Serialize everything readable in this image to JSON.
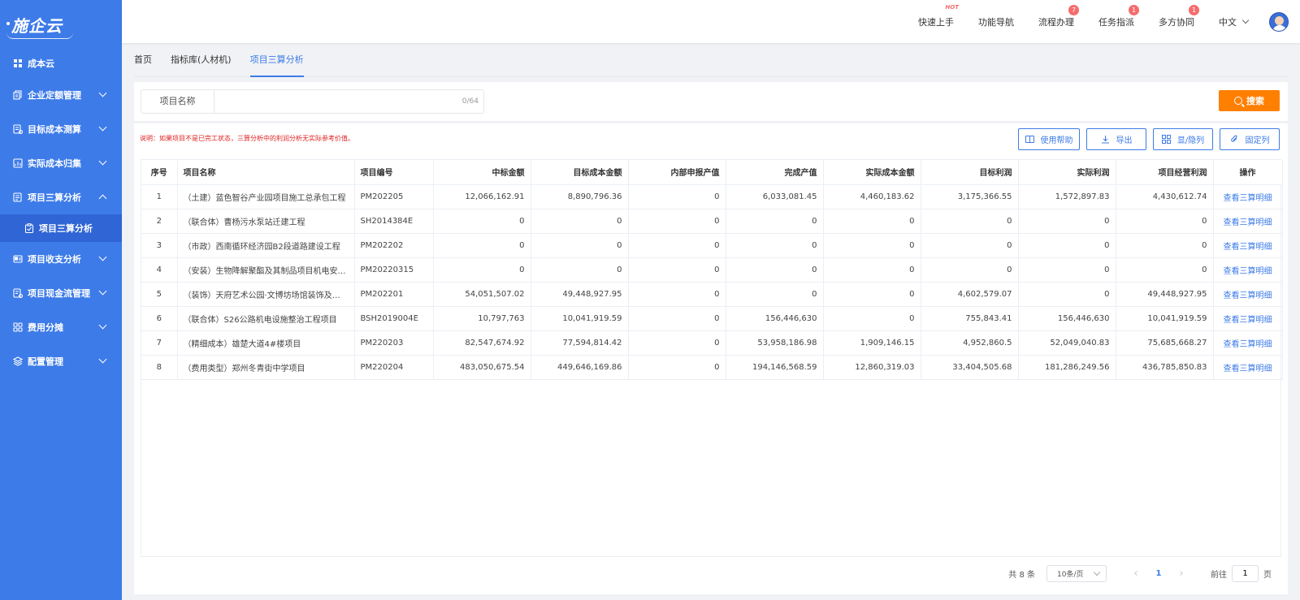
{
  "app": {
    "logo": "施企云"
  },
  "sidebar": {
    "items": [
      {
        "label": "成本云",
        "icon": "grid-icon"
      },
      {
        "label": "企业定额管理",
        "icon": "books-icon"
      },
      {
        "label": "目标成本测算",
        "icon": "calc-icon"
      },
      {
        "label": "实际成本归集",
        "icon": "chart-box-icon"
      },
      {
        "label": "项目三算分析",
        "icon": "doc-icon",
        "expanded": true
      },
      {
        "label": "项目收支分析",
        "icon": "card-icon"
      },
      {
        "label": "项目现金流管理",
        "icon": "cash-icon"
      },
      {
        "label": "费用分摊",
        "icon": "apps-icon"
      },
      {
        "label": "配置管理",
        "icon": "layers-icon"
      }
    ],
    "sub_item": {
      "label": "项目三算分析",
      "icon": "clipboard-icon"
    }
  },
  "header": {
    "nav": [
      {
        "label": "快速上手",
        "tag": "HOT"
      },
      {
        "label": "功能导航"
      },
      {
        "label": "流程办理",
        "badge": "7"
      },
      {
        "label": "任务指派",
        "badge": "1"
      },
      {
        "label": "多方协同",
        "badge": "1"
      }
    ],
    "language": "中文"
  },
  "tabs": [
    {
      "label": "首页"
    },
    {
      "label": "指标库(人材机)"
    },
    {
      "label": "项目三算分析",
      "active": true
    }
  ],
  "search": {
    "label": "项目名称",
    "placeholder": "",
    "value": "",
    "count": "0/64",
    "button": "搜索"
  },
  "notice": "说明：如果项目不是已完工状态，三算分析中的利润分析无实际参考价值。",
  "toolbar": {
    "help": "使用帮助",
    "export": "导出",
    "columns": "显/隐列",
    "fix": "固定列"
  },
  "table": {
    "headers": [
      "序号",
      "项目名称",
      "项目编号",
      "中标金额",
      "目标成本金额",
      "内部申报产值",
      "完成产值",
      "实际成本金额",
      "目标利润",
      "实际利润",
      "项目经营利润",
      "操作"
    ],
    "rows": [
      [
        "1",
        "（土建）蓝色智谷产业园项目施工总承包工程",
        "PM202205",
        "12,066,162.91",
        "8,890,796.36",
        "0",
        "6,033,081.45",
        "4,460,183.62",
        "3,175,366.55",
        "1,572,897.83",
        "4,430,612.74",
        "查看三算明细"
      ],
      [
        "2",
        "（联合体）曹杨污水泵站迁建工程",
        "SH2014384E",
        "0",
        "0",
        "0",
        "0",
        "0",
        "0",
        "0",
        "0",
        "查看三算明细"
      ],
      [
        "3",
        "（市政）西南循环经济园B2段道路建设工程",
        "PM202202",
        "0",
        "0",
        "0",
        "0",
        "0",
        "0",
        "0",
        "0",
        "查看三算明细"
      ],
      [
        "4",
        "（安装）生物降解聚酯及其制品项目机电安装工程",
        "PM20220315",
        "0",
        "0",
        "0",
        "0",
        "0",
        "0",
        "0",
        "0",
        "查看三算明细"
      ],
      [
        "5",
        "（装饰）天府艺术公园·文博坊场馆装饰及配套工程",
        "PM202201",
        "54,051,507.02",
        "49,448,927.95",
        "0",
        "0",
        "0",
        "4,602,579.07",
        "0",
        "49,448,927.95",
        "查看三算明细"
      ],
      [
        "6",
        "（联合体）S26公路机电设施整治工程项目",
        "BSH2019004E",
        "10,797,763",
        "10,041,919.59",
        "0",
        "156,446,630",
        "0",
        "755,843.41",
        "156,446,630",
        "10,041,919.59",
        "查看三算明细"
      ],
      [
        "7",
        "（精细成本）雄楚大道4#楼项目",
        "PM220203",
        "82,547,674.92",
        "77,594,814.42",
        "0",
        "53,958,186.98",
        "1,909,146.15",
        "4,952,860.5",
        "52,049,040.83",
        "75,685,668.27",
        "查看三算明细"
      ],
      [
        "8",
        "（费用类型）郑州冬青街中学项目",
        "PM220204",
        "483,050,675.54",
        "449,646,169.86",
        "0",
        "194,146,568.59",
        "12,860,319.03",
        "33,404,505.68",
        "181,286,249.56",
        "436,785,850.83",
        "查看三算明细"
      ]
    ]
  },
  "pagination": {
    "total": "共 8 条",
    "page_size": "10条/页",
    "prev": "‹",
    "current": "1",
    "next": "›",
    "goto_label": "前往",
    "goto_value": "1",
    "goto_suffix": "页"
  },
  "colors": {
    "sidebar": "#3d7be8",
    "accent": "#3d7be8",
    "search_button": "#ff7f00",
    "badge": "#f56c6c",
    "notice": "#e02020"
  }
}
